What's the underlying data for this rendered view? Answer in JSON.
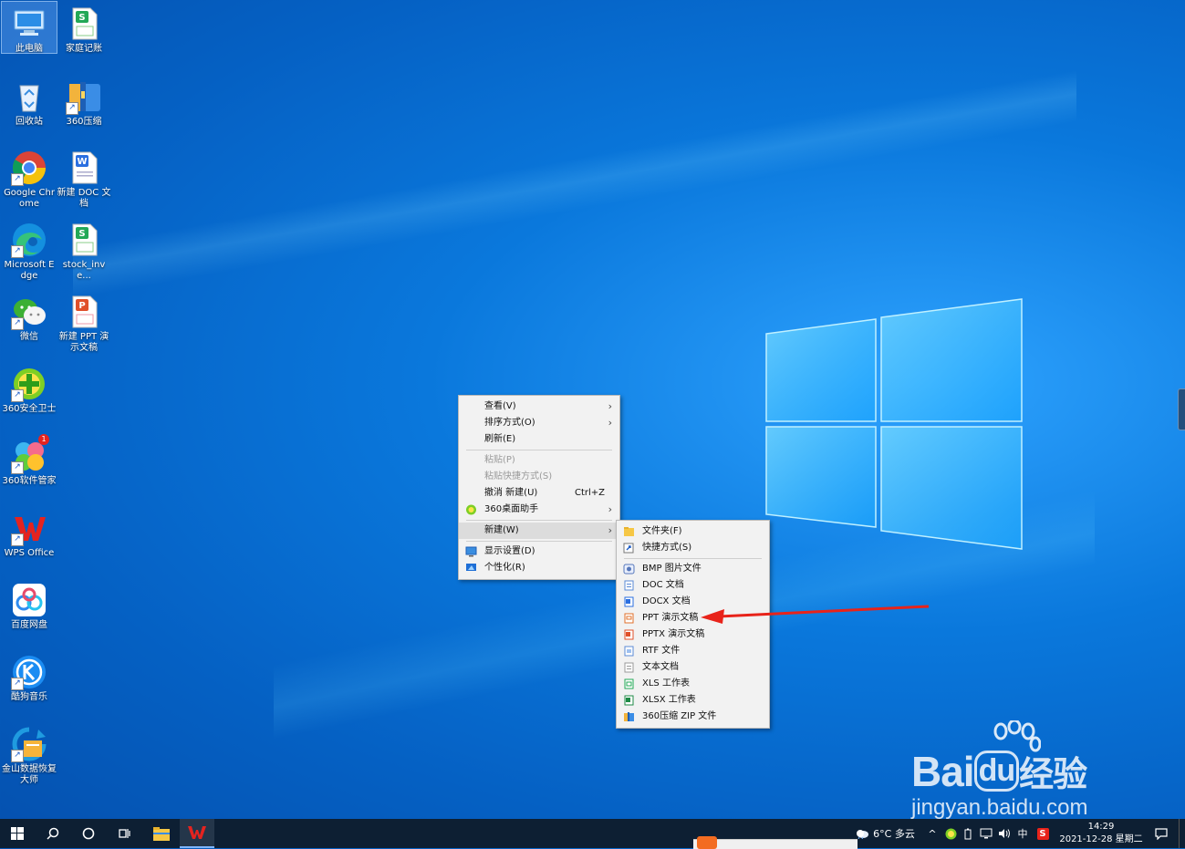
{
  "desktop_icons": [
    {
      "label": "此电脑",
      "icon": "computer-icon"
    },
    {
      "label": "家庭记账",
      "icon": "wps-spreadsheet-icon"
    },
    {
      "label": "回收站",
      "icon": "recycle-bin-icon"
    },
    {
      "label": "360压缩",
      "icon": "archive-icon"
    },
    {
      "label": "Google Chrome",
      "icon": "chrome-icon"
    },
    {
      "label": "新建 DOC 文档",
      "icon": "wps-writer-icon"
    },
    {
      "label": "Microsoft Edge",
      "icon": "edge-icon"
    },
    {
      "label": "stock_inve...",
      "icon": "wps-spreadsheet-icon"
    },
    {
      "label": "微信",
      "icon": "wechat-icon"
    },
    {
      "label": "新建 PPT 演示文稿",
      "icon": "wps-presentation-icon"
    },
    {
      "label": "360安全卫士",
      "icon": "360-security-icon"
    },
    {
      "label": "360软件管家",
      "icon": "360-software-icon",
      "badge": "1"
    },
    {
      "label": "WPS Office",
      "icon": "wps-office-icon"
    },
    {
      "label": "百度网盘",
      "icon": "baidu-netdisk-icon"
    },
    {
      "label": "酷狗音乐",
      "icon": "kugou-icon"
    },
    {
      "label": "金山数据恢复大师",
      "icon": "data-recovery-icon"
    }
  ],
  "context_menu": {
    "items": [
      {
        "label": "查看(V)",
        "submenu": true
      },
      {
        "label": "排序方式(O)",
        "submenu": true
      },
      {
        "label": "刷新(E)"
      },
      {
        "label": "粘贴(P)",
        "disabled": true
      },
      {
        "label": "粘贴快捷方式(S)",
        "disabled": true
      },
      {
        "label": "撤消 新建(U)",
        "shortcut": "Ctrl+Z"
      },
      {
        "label": "360桌面助手",
        "submenu": true,
        "icon": "360-desktop-icon"
      },
      {
        "label": "新建(W)",
        "submenu": true,
        "highlighted": true
      },
      {
        "label": "显示设置(D)",
        "icon": "display-icon"
      },
      {
        "label": "个性化(R)",
        "icon": "personalize-icon"
      }
    ]
  },
  "new_submenu": {
    "items": [
      {
        "label": "文件夹(F)",
        "icon": "folder-icon"
      },
      {
        "label": "快捷方式(S)",
        "icon": "shortcut-icon"
      },
      {
        "label": "BMP 图片文件",
        "icon": "bmp-icon"
      },
      {
        "label": "DOC 文档",
        "icon": "doc-icon"
      },
      {
        "label": "DOCX 文档",
        "icon": "docx-icon"
      },
      {
        "label": "PPT 演示文稿",
        "icon": "ppt-icon"
      },
      {
        "label": "PPTX 演示文稿",
        "icon": "pptx-icon"
      },
      {
        "label": "RTF 文件",
        "icon": "rtf-icon"
      },
      {
        "label": "文本文档",
        "icon": "txt-icon"
      },
      {
        "label": "XLS 工作表",
        "icon": "xls-icon"
      },
      {
        "label": "XLSX 工作表",
        "icon": "xlsx-icon"
      },
      {
        "label": "360压缩 ZIP 文件",
        "icon": "zip-icon"
      }
    ]
  },
  "taskbar": {
    "weather": "6°C 多云",
    "ime": "中",
    "time": "14:29",
    "date": "2021-12-28 星期二"
  },
  "watermark": {
    "brand": "Bai",
    "brand_du": "du",
    "brand_suffix": "经验",
    "url": "jingyan.baidu.com"
  },
  "colors": {
    "desktop": "#0a78dc",
    "taskbar": "#0d1f33",
    "menu_bg": "#f2f2f2",
    "annotation_arrow": "#e8231a"
  }
}
